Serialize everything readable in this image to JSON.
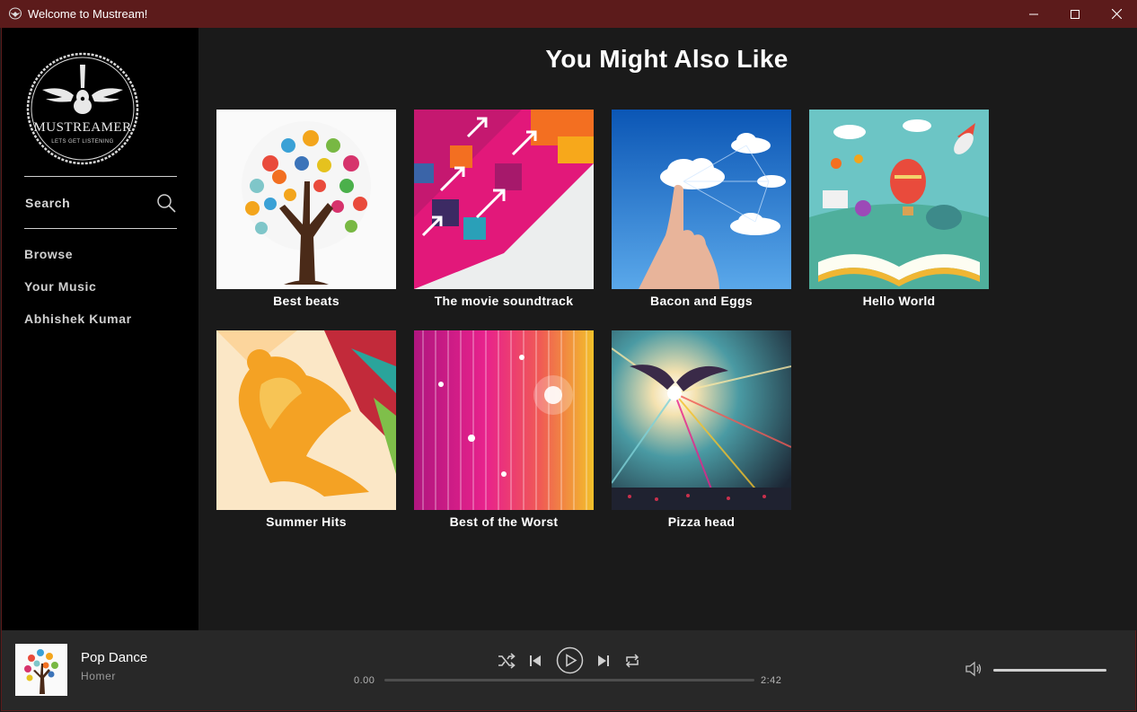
{
  "window": {
    "title": "Welcome to Mustream!"
  },
  "sidebar": {
    "logo": {
      "name": "MUSTREAMER",
      "tagline": "LETS GET LISTENING"
    },
    "search_label": "Search",
    "nav": [
      "Browse",
      "Your Music",
      "Abhishek Kumar"
    ]
  },
  "main": {
    "title": "You Might Also Like",
    "albums": [
      {
        "title": "Best beats",
        "art": "hands-tree"
      },
      {
        "title": "The movie soundtrack",
        "art": "arrows-pattern"
      },
      {
        "title": "Bacon and Eggs",
        "art": "finger-cloud"
      },
      {
        "title": "Hello World",
        "art": "storybook"
      },
      {
        "title": "Summer Hits",
        "art": "runner-silhouette"
      },
      {
        "title": "Best of the Worst",
        "art": "light-streaks"
      },
      {
        "title": "Pizza head",
        "art": "cosmic-figure"
      }
    ]
  },
  "player": {
    "track": "Pop Dance",
    "artist": "Homer",
    "elapsed": "0.00",
    "duration": "2:42",
    "progress": 0,
    "volume": 1.0
  },
  "colors": {
    "titlebar": "#5c1b1b",
    "sidebar": "#000000",
    "main": "#1a1a1a",
    "player": "#282828"
  }
}
